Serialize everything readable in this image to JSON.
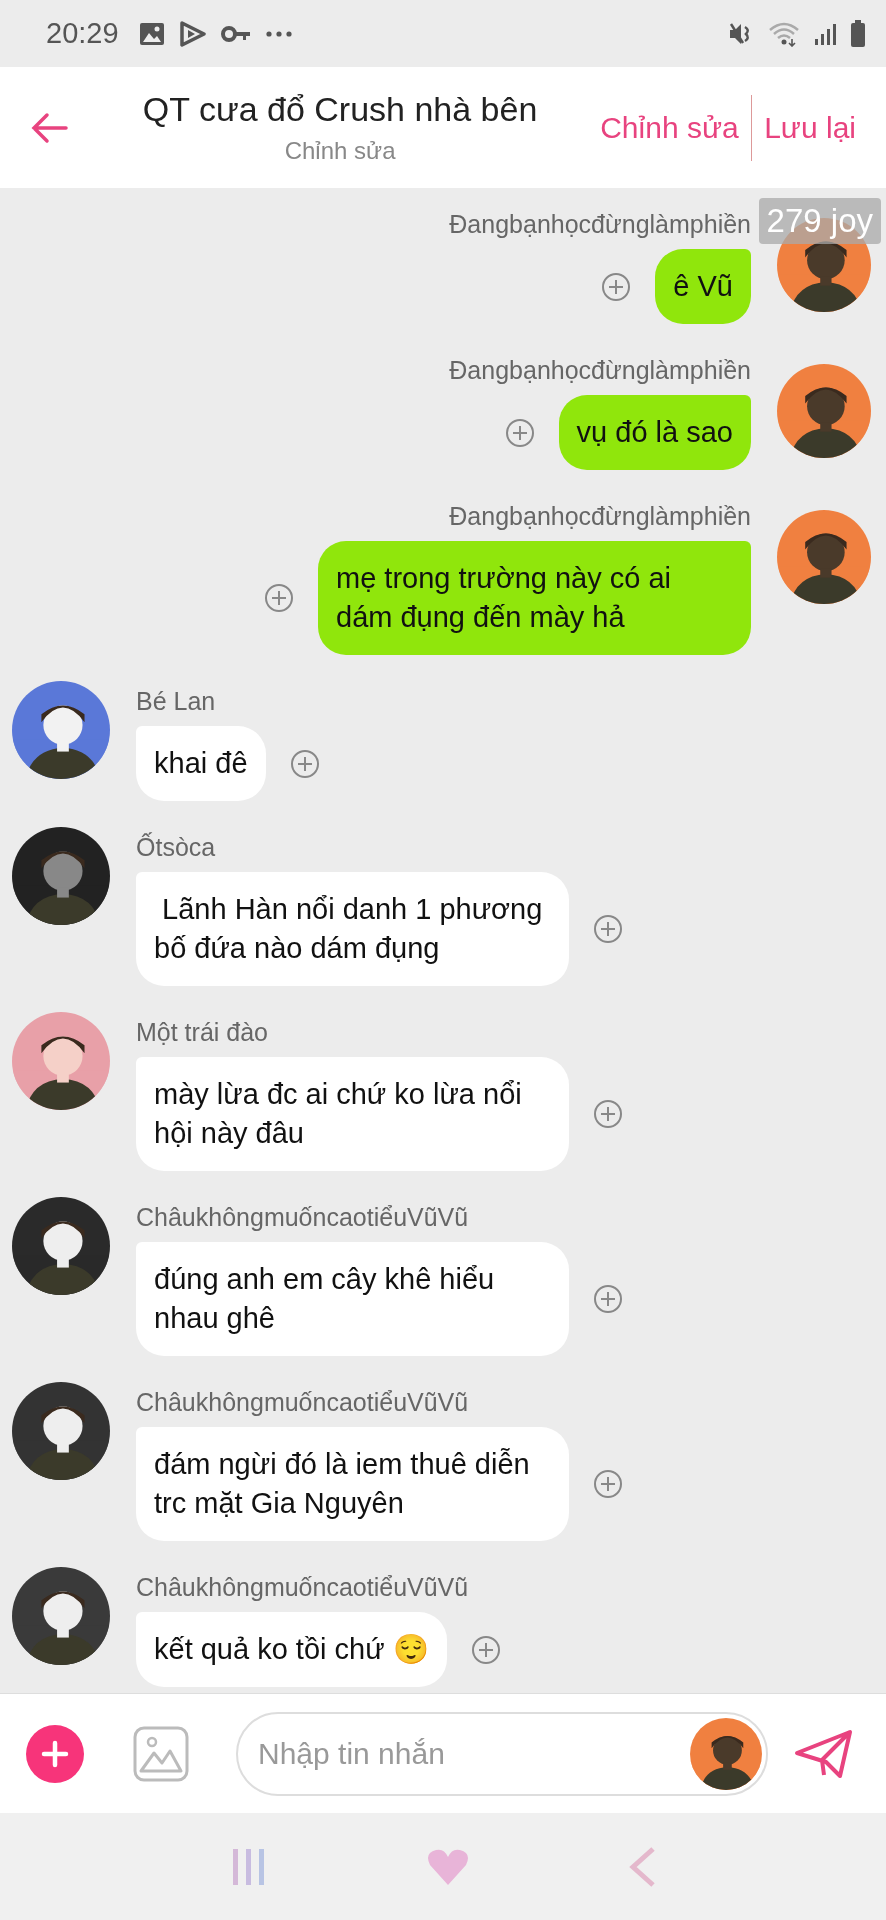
{
  "status_bar": {
    "time": "20:29"
  },
  "header": {
    "title": "QT cưa đổ Crush nhà bên",
    "subtitle": "Chỉnh sửa",
    "actions": [
      "Chỉnh sửa",
      "Lưu lại"
    ]
  },
  "overlay_badge": "279 joy",
  "messages": [
    {
      "kind": "sent",
      "sender": "Đangbạnhọcđừnglàmphiền",
      "text": "ê Vũ"
    },
    {
      "kind": "sent",
      "sender": "Đangbạnhọcđừnglàmphiền",
      "text": "vụ đó là sao"
    },
    {
      "kind": "sent",
      "sender": "Đangbạnhọcđừnglàmphiền",
      "text": "mẹ trong trường này có ai dám đụng đến mày hả"
    },
    {
      "kind": "received",
      "sender": "Bé Lan",
      "text": "khai đê"
    },
    {
      "kind": "received",
      "sender": "Ốtsòca",
      "text": " Lãnh Hàn nổi danh 1 phương bố đứa nào dám đụng"
    },
    {
      "kind": "received",
      "sender": "Một trái đào",
      "text": "mày lừa đc ai chứ ko lừa nổi hội này đâu"
    },
    {
      "kind": "received",
      "sender": "ChâukhôngmuốncaotiểuVũVũ",
      "text": "đúng anh em cây khê hiểu nhau ghê"
    },
    {
      "kind": "received",
      "sender": "ChâukhôngmuốncaotiểuVũVũ",
      "text": "đám ngừi đó là iem thuê diễn trc mặt Gia Nguyên"
    },
    {
      "kind": "received",
      "sender": "ChâukhôngmuốncaotiểuVũVũ",
      "text": "kết quả ko tồi chứ 😌"
    }
  ],
  "composer": {
    "placeholder": "Nhập tin nhắn"
  }
}
